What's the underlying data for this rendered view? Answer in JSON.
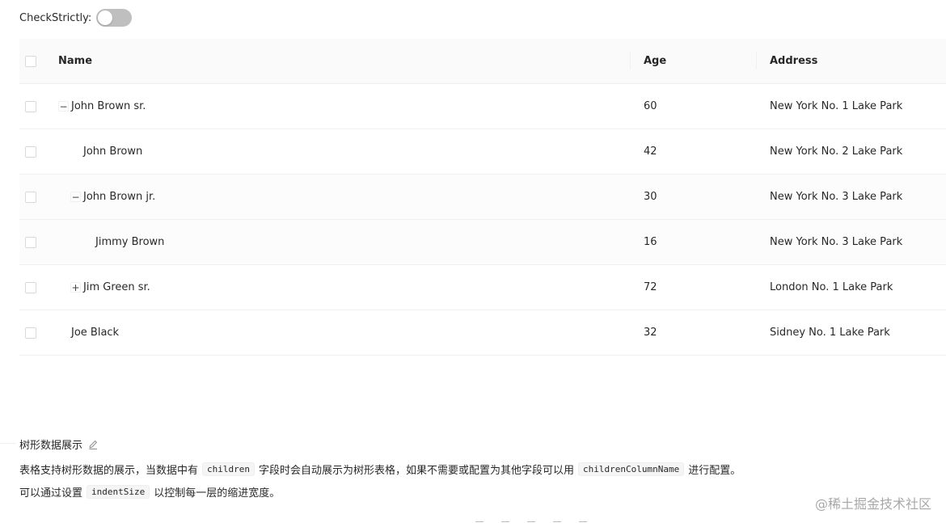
{
  "toolbar": {
    "label": "CheckStrictly:",
    "switch_checked": false
  },
  "table": {
    "columns": {
      "name": "Name",
      "age": "Age",
      "address": "Address"
    },
    "rows": [
      {
        "name": "John Brown sr.",
        "age": "60",
        "address": "New York No. 1 Lake Park",
        "level": 0,
        "expander": "−"
      },
      {
        "name": "John Brown",
        "age": "42",
        "address": "New York No. 2 Lake Park",
        "level": 1,
        "expander": ""
      },
      {
        "name": "John Brown jr.",
        "age": "30",
        "address": "New York No. 3 Lake Park",
        "level": 1,
        "expander": "−"
      },
      {
        "name": "Jimmy Brown",
        "age": "16",
        "address": "New York No. 3 Lake Park",
        "level": 2,
        "expander": ""
      },
      {
        "name": "Jim Green sr.",
        "age": "72",
        "address": "London No. 1 Lake Park",
        "level": 1,
        "expander": "+"
      },
      {
        "name": "Joe Black",
        "age": "32",
        "address": "Sidney No. 1 Lake Park",
        "level": 0,
        "expander": ""
      }
    ]
  },
  "doc": {
    "title": "树形数据展示",
    "line1": {
      "before": "表格支持树形数据的展示，当数据中有",
      "code1": "children",
      "middle": "字段时会自动展示为树形表格，如果不需要或配置为其他字段可以用",
      "code2": "childrenColumnName",
      "after": "进行配置。"
    },
    "line2": {
      "before": "可以通过设置",
      "code": "indentSize",
      "after": "以控制每一层的缩进宽度。"
    }
  },
  "watermark": "@稀土掘金技术社区"
}
